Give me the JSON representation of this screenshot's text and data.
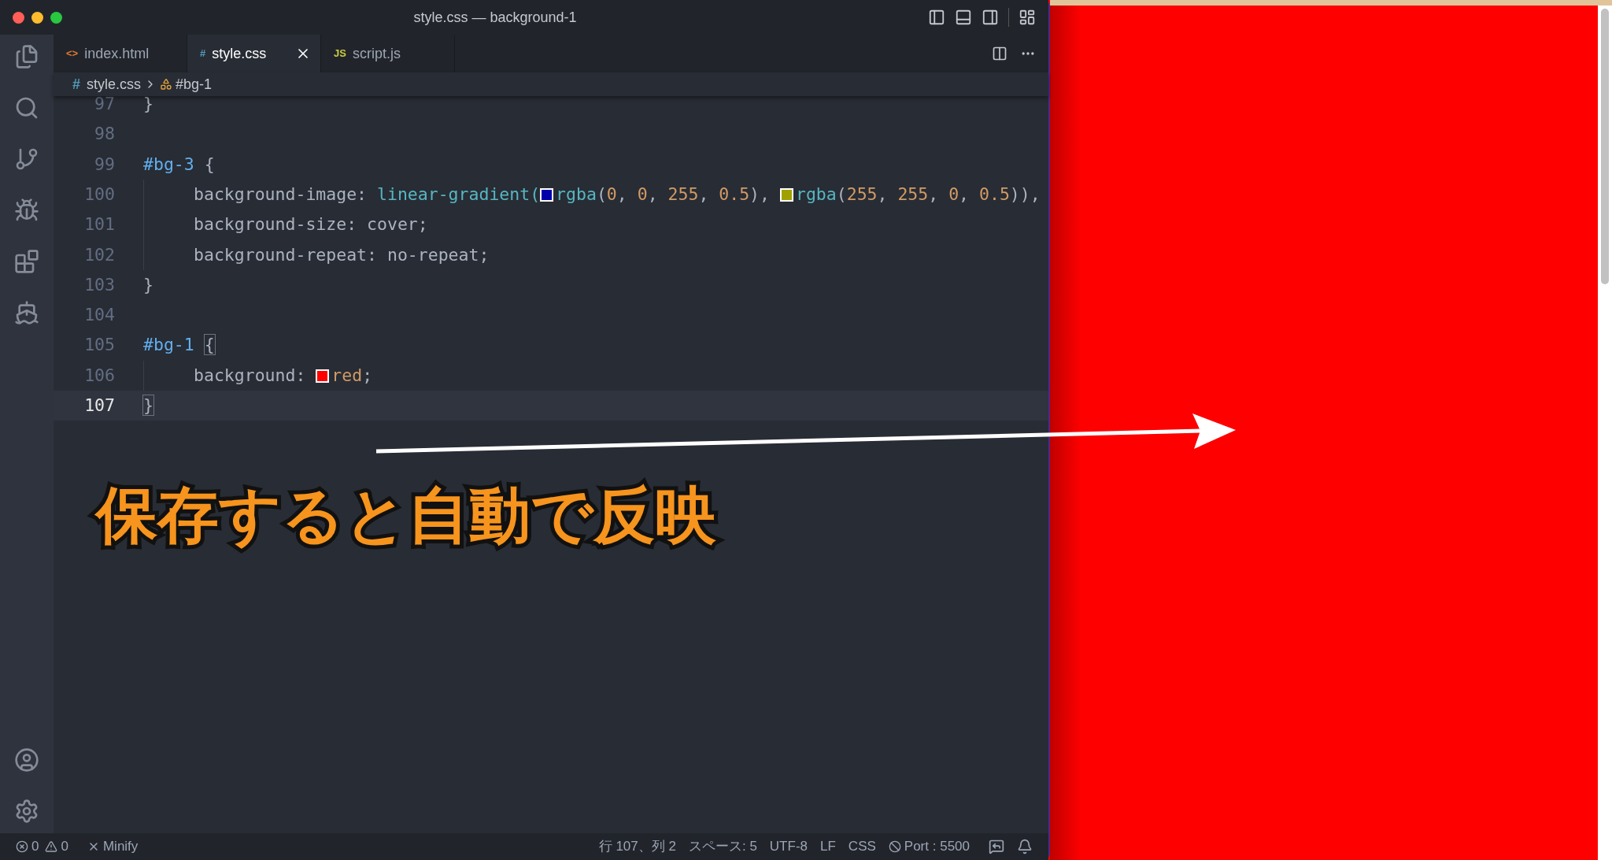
{
  "window": {
    "title": "style.css — background-1"
  },
  "tabs": [
    {
      "label": "index.html",
      "kind": "html",
      "icon": "<>",
      "selected": false
    },
    {
      "label": "style.css",
      "kind": "css",
      "icon": "#",
      "selected": true
    },
    {
      "label": "script.js",
      "kind": "js",
      "icon": "JS",
      "selected": false
    }
  ],
  "breadcrumb": {
    "file_icon": "#",
    "file": "style.css",
    "symbol": "#bg-1"
  },
  "editor": {
    "lines": [
      {
        "number": "97",
        "current": false,
        "indented": false,
        "tokens": [
          {
            "kind": "punct",
            "text": "}"
          }
        ]
      },
      {
        "number": "98",
        "current": false,
        "indented": false
      },
      {
        "number": "99",
        "current": false,
        "indented": false,
        "tokens": [
          {
            "kind": "selector",
            "text": "#bg-3"
          },
          {
            "kind": "punct",
            "text": " {"
          }
        ]
      },
      {
        "number": "100",
        "current": false,
        "indented": true,
        "tokens": [
          {
            "kind": "prop",
            "text": "background-image: "
          },
          {
            "kind": "func",
            "text": "linear-gradient("
          },
          {
            "kind": "swatch",
            "color": "#0000aa"
          },
          {
            "kind": "func",
            "text": "rgba"
          },
          {
            "kind": "punct",
            "text": "("
          },
          {
            "kind": "num",
            "text": "0"
          },
          {
            "kind": "punct",
            "text": ", "
          },
          {
            "kind": "num",
            "text": "0"
          },
          {
            "kind": "punct",
            "text": ", "
          },
          {
            "kind": "num",
            "text": "255"
          },
          {
            "kind": "punct",
            "text": ", "
          },
          {
            "kind": "num",
            "text": "0.5"
          },
          {
            "kind": "punct",
            "text": "), "
          },
          {
            "kind": "swatch",
            "color": "#a0a000"
          },
          {
            "kind": "func",
            "text": "rgba"
          },
          {
            "kind": "punct",
            "text": "("
          },
          {
            "kind": "num",
            "text": "255"
          },
          {
            "kind": "punct",
            "text": ", "
          },
          {
            "kind": "num",
            "text": "255"
          },
          {
            "kind": "punct",
            "text": ", "
          },
          {
            "kind": "num",
            "text": "0"
          },
          {
            "kind": "punct",
            "text": ", "
          },
          {
            "kind": "num",
            "text": "0.5"
          },
          {
            "kind": "punct",
            "text": ")),"
          }
        ]
      },
      {
        "number": "101",
        "current": false,
        "indented": true,
        "tokens": [
          {
            "kind": "prop",
            "text": "background-size: cover;"
          }
        ]
      },
      {
        "number": "102",
        "current": false,
        "indented": true,
        "tokens": [
          {
            "kind": "prop",
            "text": "background-repeat: no-repeat;"
          }
        ]
      },
      {
        "number": "103",
        "current": false,
        "indented": false,
        "tokens": [
          {
            "kind": "punct",
            "text": "}"
          }
        ]
      },
      {
        "number": "104",
        "current": false,
        "indented": false
      },
      {
        "number": "105",
        "current": false,
        "indented": false,
        "tokens": [
          {
            "kind": "selector",
            "text": "#bg-1 "
          },
          {
            "kind": "bracket",
            "text": "{"
          }
        ]
      },
      {
        "number": "106",
        "current": false,
        "indented": true,
        "tokens": [
          {
            "kind": "prop",
            "text": "background: "
          },
          {
            "kind": "swatch",
            "color": "#ff0000"
          },
          {
            "kind": "value",
            "text": "red"
          },
          {
            "kind": "punct",
            "text": ";"
          }
        ]
      },
      {
        "number": "107",
        "current": true,
        "indented": false,
        "tokens": [
          {
            "kind": "bracket",
            "text": "}"
          }
        ]
      }
    ]
  },
  "caption": "保存すると自動で反映",
  "status_bar": {
    "errors": "0",
    "warnings": "0",
    "minify": "Minify",
    "position": "行 107、列 2",
    "spaces": "スペース: 5",
    "encoding": "UTF-8",
    "eol": "LF",
    "language": "CSS",
    "port": "Port : 5500"
  }
}
